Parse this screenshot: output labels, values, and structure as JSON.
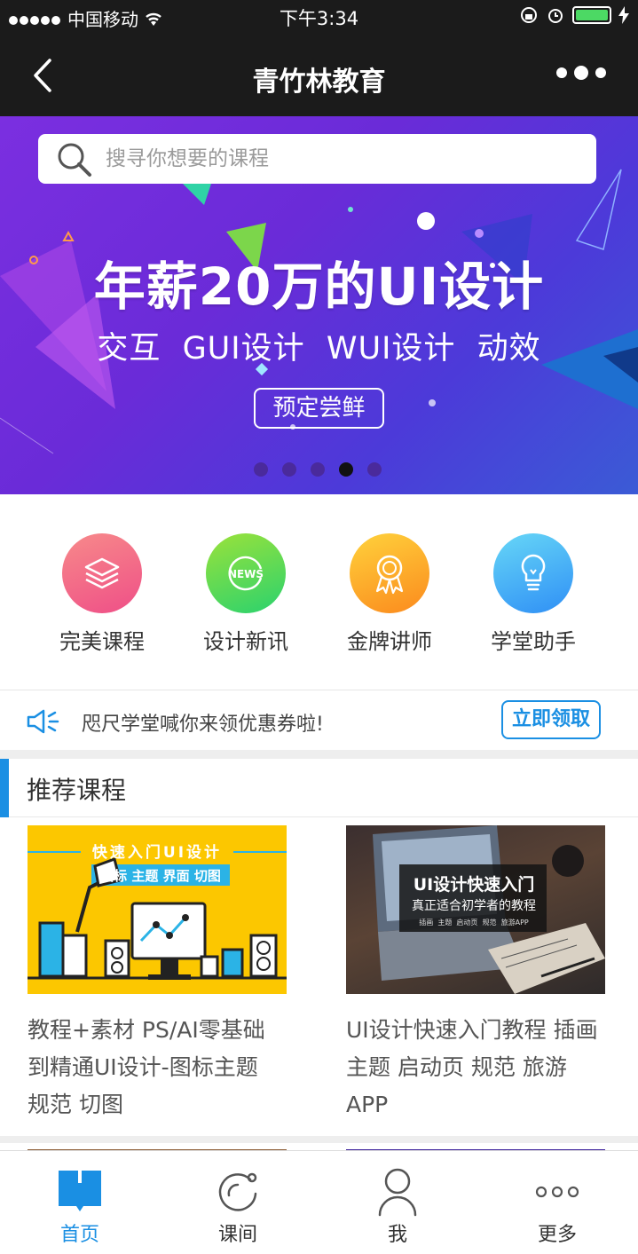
{
  "status_bar": {
    "carrier": "中国移动",
    "time": "下午3:34"
  },
  "nav": {
    "title": "青竹林教育"
  },
  "banner": {
    "search_placeholder": "搜寻你想要的课程",
    "headline": "年薪20万的UI设计",
    "subline": "交互  GUI设计  WUI设计  动效",
    "cta": "预定尝鲜",
    "pages": 5,
    "active_page": 4
  },
  "categories": [
    {
      "label": "完美课程",
      "icon": "layers-icon",
      "color": "#f2607c"
    },
    {
      "label": "设计新讯",
      "icon": "news-icon",
      "color": "#4cd964"
    },
    {
      "label": "金牌讲师",
      "icon": "medal-icon",
      "color": "#fbb321"
    },
    {
      "label": "学堂助手",
      "icon": "lightbulb-icon",
      "color": "#3fb0f5"
    }
  ],
  "notice": {
    "text": "咫尺学堂喊你来领优惠券啦!",
    "button": "立即领取"
  },
  "section": {
    "title": "推荐课程"
  },
  "courses": [
    {
      "title": "教程+素材 PS/AI零基础到精通UI设计-图标主题 规范 切图",
      "thumb_title": "快速入门UI设计",
      "thumb_tags": "图标 主题 界面 切图"
    },
    {
      "title": "UI设计快速入门教程 插画 主题 启动页 规范 旅游APP",
      "thumb_title": "UI设计快速入门",
      "thumb_sub": "真正适合初学者的教程",
      "thumb_tags": "插画  主题  启动页  规范  旅游APP"
    }
  ],
  "tabbar": [
    {
      "label": "首页",
      "icon": "home-book-icon",
      "active": true
    },
    {
      "label": "课间",
      "icon": "refresh-icon",
      "active": false
    },
    {
      "label": "我",
      "icon": "user-icon",
      "active": false
    },
    {
      "label": "更多",
      "icon": "more-dots-icon",
      "active": false
    }
  ],
  "colors": {
    "accent": "#1a8fe3",
    "topbar": "#1b1b1b"
  }
}
